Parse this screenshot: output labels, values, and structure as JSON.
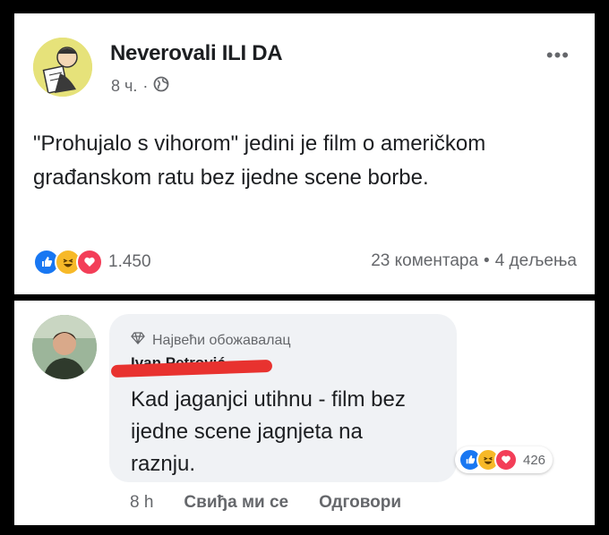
{
  "post": {
    "page_name": "Neverovali ILI DA",
    "time": "8 ч.",
    "separator": "·",
    "privacy_icon": "globe-icon",
    "more_label": "•••",
    "text": "\"Prohujalo s vihorom\" jedini je film o američkom građanskom ratu bez ijedne scene borbe.",
    "reactions": [
      "like-icon",
      "haha-icon",
      "love-icon"
    ],
    "reaction_count": "1.450",
    "comments": "23 коментара",
    "stats_separator": "•",
    "shares": "4 дељења"
  },
  "comment": {
    "badge_icon": "diamond-icon",
    "badge": "Највећи обожавалац",
    "author": "Ivan Petrović",
    "text": "Kad jaganjci utihnu - film bez ijedne scene jagnjeta na raznju.",
    "reactions": [
      "like-icon",
      "haha-icon",
      "love-icon"
    ],
    "reaction_count": "426",
    "time": "8 h",
    "like_action": "Свиђа ми се",
    "reply_action": "Одговори"
  },
  "colors": {
    "like": "#1877f2",
    "haha": "#f7b928",
    "love": "#f33e58",
    "redaction": "#e8322f"
  }
}
